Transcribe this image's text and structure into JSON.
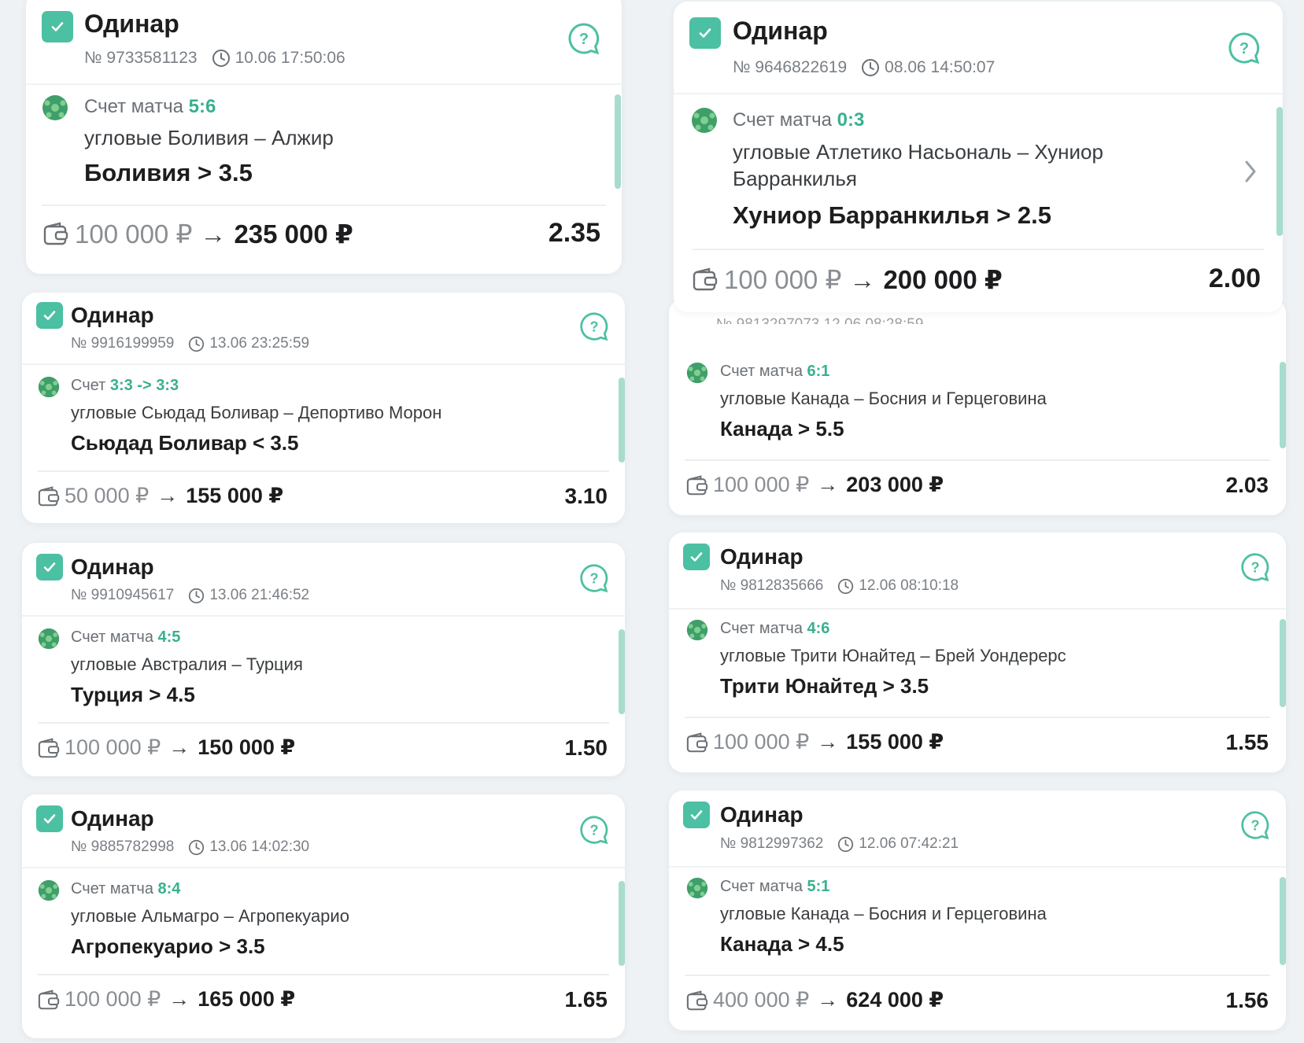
{
  "accent": "#4cc0a2",
  "cards": [
    {
      "type": "Одинар",
      "number": "№ 9733581123",
      "time": "10.06 17:50:06",
      "score_label": "Счет матча",
      "score": "5:6",
      "match": "угловые Боливия – Алжир",
      "pick": "Боливия > 3.5",
      "stake": "100 000 ₽",
      "win": "235 000 ₽",
      "odds": "2.35"
    },
    {
      "type": "Одинар",
      "number": "№ 9916199959",
      "time": "13.06 23:25:59",
      "score_label": "Счет",
      "score": "3:3 -> 3:3",
      "match": "угловые Сьюдад Боливар – Депортиво Морон",
      "pick": "Сьюдад Боливар < 3.5",
      "stake": "50 000 ₽",
      "win": "155 000 ₽",
      "odds": "3.10"
    },
    {
      "type": "Одинар",
      "number": "№ 9910945617",
      "time": "13.06 21:46:52",
      "score_label": "Счет матча",
      "score": "4:5",
      "match": "угловые Австралия – Турция",
      "pick": "Турция > 4.5",
      "stake": "100 000 ₽",
      "win": "150 000 ₽",
      "odds": "1.50"
    },
    {
      "type": "Одинар",
      "number": "№ 9885782998",
      "time": "13.06 14:02:30",
      "score_label": "Счет матча",
      "score": "8:4",
      "match": "угловые Альмагро – Агропекуарио",
      "pick": "Агропекуарио > 3.5",
      "stake": "100 000 ₽",
      "win": "165 000 ₽",
      "odds": "1.65"
    },
    {
      "type": "Одинар",
      "number": "№ 9646822619",
      "time": "08.06 14:50:07",
      "score_label": "Счет матча",
      "score": "0:3",
      "match": "угловые Атлетико Насьональ – Хуниор",
      "match2": "Барранкилья",
      "pick": "Хуниор Барранкилья > 2.5",
      "stake": "100 000 ₽",
      "win": "200 000 ₽",
      "odds": "2.00"
    },
    {
      "score_label": "Счет матча",
      "score": "6:1",
      "match": "угловые Канада – Босния и Герцеговина",
      "pick": "Канада > 5.5",
      "stake": "100 000 ₽",
      "win": "203 000 ₽",
      "odds": "2.03"
    },
    {
      "type": "Одинар",
      "number": "№ 9812835666",
      "time": "12.06 08:10:18",
      "score_label": "Счет матча",
      "score": "4:6",
      "match": "угловые Трити Юнайтед – Брей Уондерерс",
      "pick": "Трити Юнайтед > 3.5",
      "stake": "100 000 ₽",
      "win": "155 000 ₽",
      "odds": "1.55"
    },
    {
      "type": "Одинар",
      "number": "№ 9812997362",
      "time": "12.06 07:42:21",
      "score_label": "Счет матча",
      "score": "5:1",
      "match": "угловые Канада – Босния и Герцеговина",
      "pick": "Канада > 4.5",
      "stake": "400 000 ₽",
      "win": "624 000 ₽",
      "odds": "1.56"
    }
  ]
}
